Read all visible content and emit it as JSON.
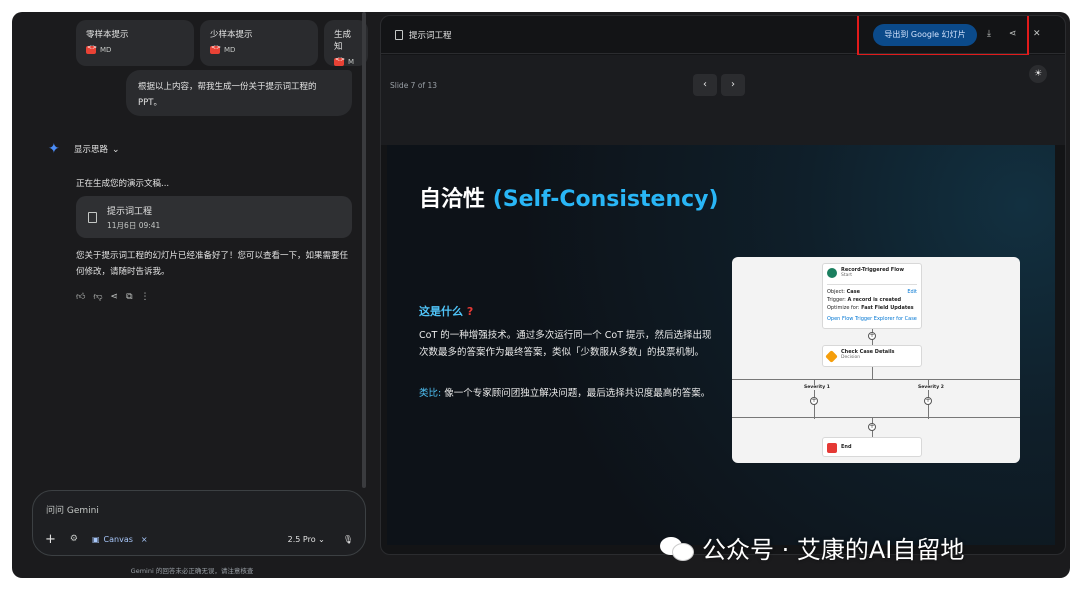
{
  "chat": {
    "file_chips": [
      {
        "title": "零样本提示",
        "type": "MD"
      },
      {
        "title": "少样本提示",
        "type": "MD"
      },
      {
        "title": "生成知",
        "type": "M"
      }
    ],
    "user_message": "根据以上内容，帮我生成一份关于提示词工程的PPT。",
    "thinking_label": "显示思路",
    "generating_text": "正在生成您的演示文稿...",
    "doc_card": {
      "title": "提示词工程",
      "date": "11月6日 09:41"
    },
    "answer": "您关于提示词工程的幻灯片已经准备好了！您可以查看一下，如果需要任何修改，请随时告诉我。",
    "input_placeholder": "问问 Gemini",
    "canvas_chip": "Canvas",
    "model": "2.5 Pro",
    "disclaimer": "Gemini 的回答未必正确无误，请注意核查"
  },
  "canvas": {
    "title": "提示词工程",
    "export_button": "导出到 Google 幻灯片",
    "slide_counter": "Slide 7 of 13",
    "slide": {
      "title_zh": "自洽性",
      "title_en": "(Self-Consistency)",
      "what_label": "这是什么",
      "what_mark": "?",
      "body": "CoT 的一种增强技术。通过多次运行同一个 CoT 提示，然后选择出现次数最多的答案作为最终答案，类似「少数服从多数」的投票机制。",
      "analogy_label": "类比:",
      "analogy_text": " 像一个专家顾问团独立解决问题，最后选择共识度最高的答案。"
    },
    "flow": {
      "start_title": "Record-Triggered Flow",
      "start_sub": "Start",
      "object_label": "Object:",
      "object_value": "Case",
      "edit": "Edit",
      "trigger_label": "Trigger:",
      "trigger_value": "A record is created",
      "optimize_label": "Optimize for:",
      "optimize_value": "Fast Field Updates",
      "open_link": "Open Flow Trigger Explorer for Case",
      "decision_title": "Check Case Details",
      "decision_sub": "Decision",
      "branch1": "Severity 1",
      "branch2": "Severity 2",
      "end": "End"
    }
  },
  "watermark": "公众号 · 艾康的AI自留地",
  "colors": {
    "accent": "#29b6f6",
    "highlight": "#e11b1b",
    "export_button": "#0b4a8a"
  }
}
